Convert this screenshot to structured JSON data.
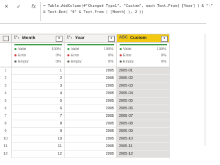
{
  "formula_bar": {
    "cancel_glyph": "✕",
    "commit_glyph": "✓",
    "fx_label": "fx",
    "lines": [
      "= Table.AddColumn(#\"Changed Type1\", \"Custom\", each Text.From( [Year] ) & \"-\"",
      "& Text.End( \"0\" & Text.From ( [Month] ), 2 ))"
    ]
  },
  "columns": [
    {
      "type_glyph": "1²₃",
      "label": "Month"
    },
    {
      "type_glyph": "1²₃",
      "label": "Year"
    },
    {
      "type_glyph": "ABC",
      "label": "Custom"
    }
  ],
  "quality": {
    "valid_label": "Valid",
    "error_label": "Error",
    "empty_label": "Empty",
    "valid_pct": "100%",
    "error_pct": "0%",
    "empty_pct": "0%",
    "valid_color": "#3a9b4a",
    "error_color": "#d13438",
    "empty_color": "#605e5c"
  },
  "rows": [
    {
      "n": "1",
      "month": "1",
      "year": "2005",
      "custom": "2005-01"
    },
    {
      "n": "2",
      "month": "2",
      "year": "2005",
      "custom": "2005-02"
    },
    {
      "n": "3",
      "month": "3",
      "year": "2005",
      "custom": "2005-03"
    },
    {
      "n": "4",
      "month": "4",
      "year": "2005",
      "custom": "2005-04"
    },
    {
      "n": "5",
      "month": "5",
      "year": "2005",
      "custom": "2005-05"
    },
    {
      "n": "6",
      "month": "6",
      "year": "2005",
      "custom": "2005-06"
    },
    {
      "n": "7",
      "month": "7",
      "year": "2005",
      "custom": "2005-07"
    },
    {
      "n": "8",
      "month": "8",
      "year": "2005",
      "custom": "2005-08"
    },
    {
      "n": "9",
      "month": "9",
      "year": "2005",
      "custom": "2005-09"
    },
    {
      "n": "10",
      "month": "10",
      "year": "2005",
      "custom": "2005-10"
    },
    {
      "n": "11",
      "month": "11",
      "year": "2005",
      "custom": "2005-11"
    },
    {
      "n": "12",
      "month": "12",
      "year": "2005",
      "custom": "2005-12"
    }
  ]
}
